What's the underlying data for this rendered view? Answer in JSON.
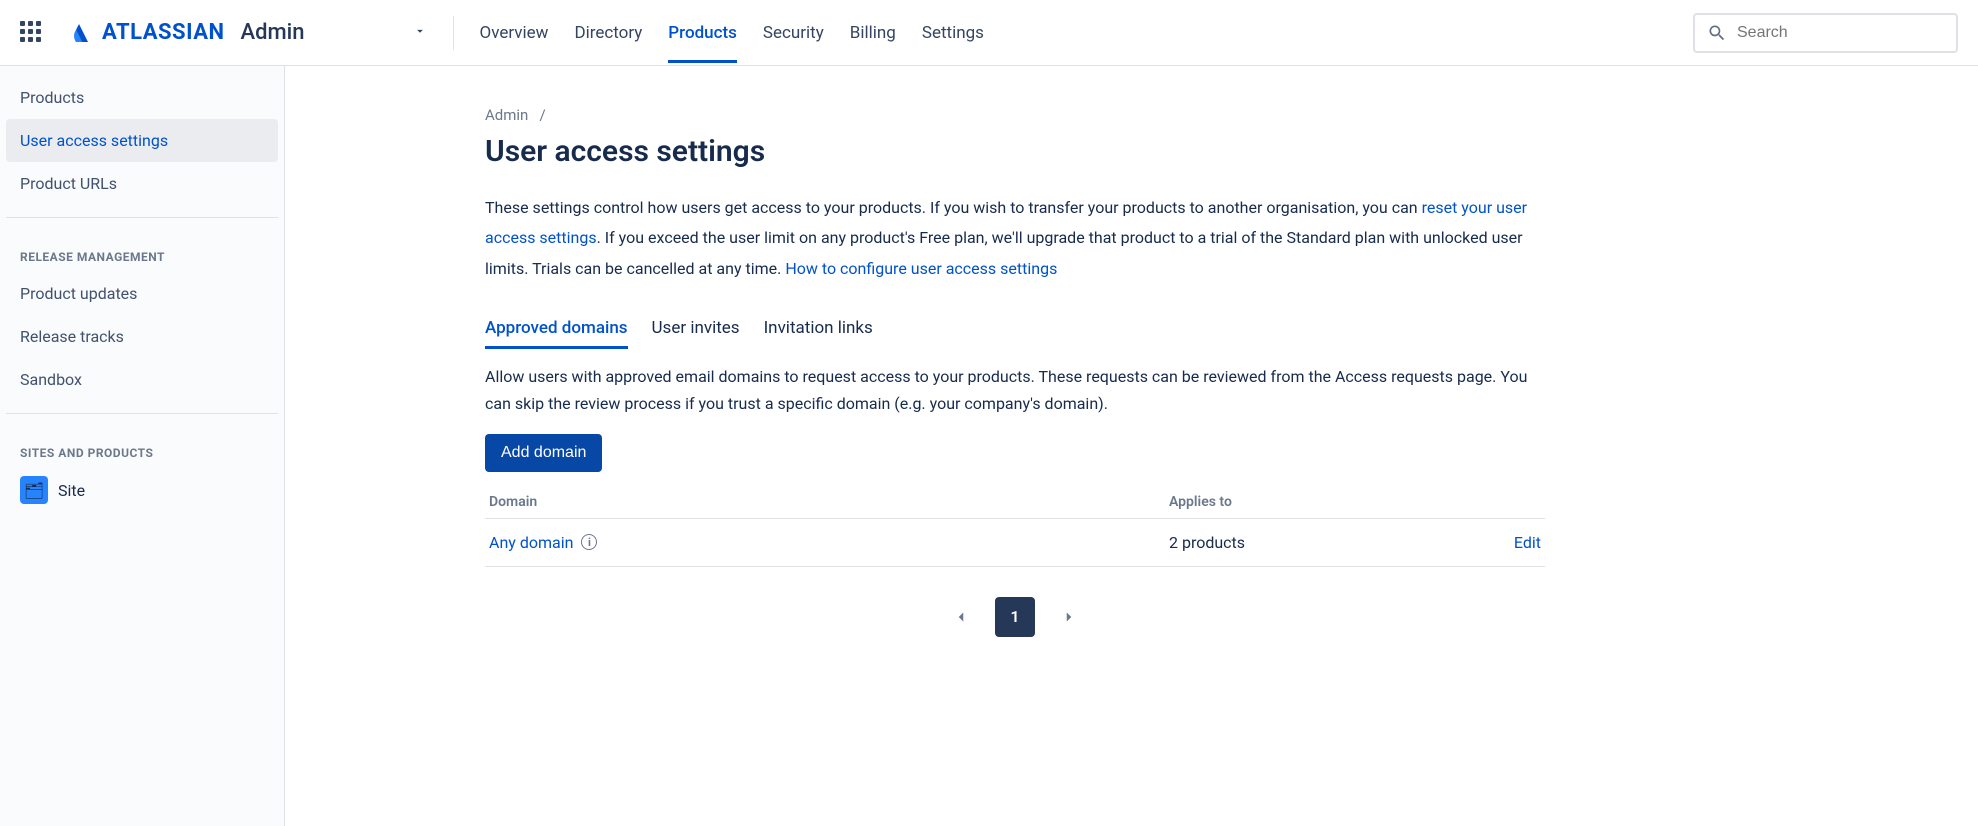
{
  "header": {
    "brand_name": "ATLASSIAN",
    "brand_suffix": "Admin",
    "search_placeholder": "Search",
    "nav": [
      {
        "label": "Overview",
        "active": false
      },
      {
        "label": "Directory",
        "active": false
      },
      {
        "label": "Products",
        "active": true
      },
      {
        "label": "Security",
        "active": false
      },
      {
        "label": "Billing",
        "active": false
      },
      {
        "label": "Settings",
        "active": false
      }
    ]
  },
  "sidebar": {
    "items_top": [
      {
        "label": "Products",
        "active": false
      },
      {
        "label": "User access settings",
        "active": true
      },
      {
        "label": "Product URLs",
        "active": false
      }
    ],
    "section1_heading": "RELEASE MANAGEMENT",
    "items_release": [
      {
        "label": "Product updates"
      },
      {
        "label": "Release tracks"
      },
      {
        "label": "Sandbox"
      }
    ],
    "section2_heading": "SITES AND PRODUCTS",
    "site_label": "Site"
  },
  "breadcrumb": {
    "root": "Admin",
    "sep": "/"
  },
  "page": {
    "title": "User access settings",
    "desc_part1": "These settings control how users get access to your products. If you wish to transfer your products to another organisation, you can ",
    "reset_link": "reset your user access settings",
    "desc_part2": ". If you exceed the user limit on any product's Free plan, we'll upgrade that product to a trial of the Standard plan with unlocked user limits. Trials can be cancelled at any time. ",
    "howto_link": "How to configure user access settings"
  },
  "tabs": [
    {
      "label": "Approved domains",
      "active": true
    },
    {
      "label": "User invites",
      "active": false
    },
    {
      "label": "Invitation links",
      "active": false
    }
  ],
  "tab_content": {
    "desc": "Allow users with approved email domains to request access to your products. These requests can be reviewed from the Access requests page. You can skip the review process if you trust a specific domain (e.g. your company's domain).",
    "add_button": "Add domain",
    "columns": {
      "domain": "Domain",
      "applies": "Applies to"
    },
    "rows": [
      {
        "domain": "Any domain",
        "applies": "2 products",
        "action": "Edit"
      }
    ]
  },
  "pagination": {
    "current": "1"
  }
}
